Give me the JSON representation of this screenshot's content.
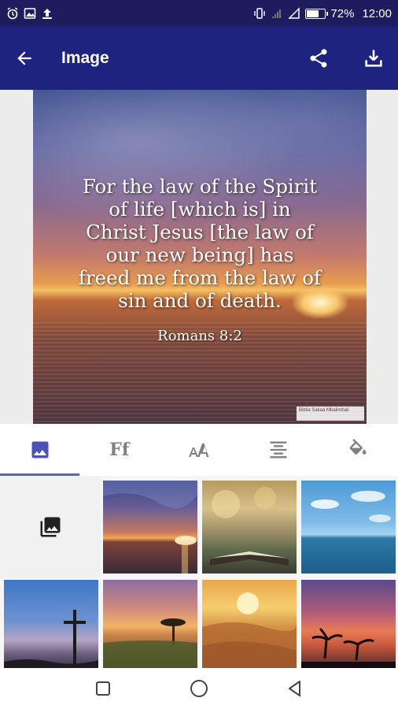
{
  "status": {
    "battery": "72%",
    "time": "12:00",
    "battery_level": 0.72
  },
  "header": {
    "back_icon": "arrow-back-icon",
    "title": "Image",
    "share_icon": "share-icon",
    "download_icon": "download-icon"
  },
  "preview": {
    "verse_lines": [
      "For the law of the Spirit",
      "of life [which is] in",
      "Christ Jesus [the law of",
      "our new being] has",
      "freed me from the law of",
      "sin and of death."
    ],
    "reference": "Romans 8:2",
    "watermark": "Biblia Sakaa Mbalimbali"
  },
  "tabs": [
    {
      "name": "image-tab",
      "icon": "image-icon",
      "active": true
    },
    {
      "name": "font-tab",
      "label": "Ff",
      "active": false
    },
    {
      "name": "text-size-tab",
      "icon": "text-size-icon",
      "active": false
    },
    {
      "name": "alignment-tab",
      "icon": "align-center-icon",
      "active": false
    },
    {
      "name": "color-tab",
      "icon": "paint-bucket-icon",
      "active": false
    }
  ],
  "gallery": {
    "add_icon": "photo-library-icon",
    "thumbnails": [
      {
        "scene": "sunset-clouds-sea"
      },
      {
        "scene": "bible-on-blurred-background"
      },
      {
        "scene": "blue-sky-ocean"
      },
      {
        "scene": "cross-at-dusk"
      },
      {
        "scene": "acacia-tree-sunset"
      },
      {
        "scene": "desert-dunes-sun"
      },
      {
        "scene": "palm-trees-sunset"
      }
    ]
  },
  "colors": {
    "status_bar": "#1c1c5e",
    "app_bar": "#1d237e",
    "accent": "#5b63c4"
  }
}
